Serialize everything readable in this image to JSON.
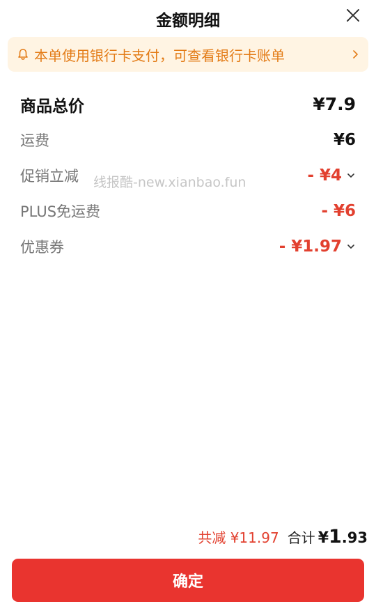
{
  "header": {
    "title": "金额明细"
  },
  "notice": {
    "text": "本单使用银行卡支付，可查看银行卡账单"
  },
  "rows": [
    {
      "label": "商品总价",
      "value": "¥7.9"
    },
    {
      "label": "运费",
      "value": "¥6"
    },
    {
      "label": "促销立减",
      "value": "- ¥4"
    },
    {
      "label": "PLUS免运费",
      "value": "- ¥6"
    },
    {
      "label": "优惠券",
      "value": "- ¥1.97"
    }
  ],
  "watermark": "线报酷-new.xianbao.fun",
  "summary": {
    "saved": "共减 ¥11.97",
    "total_label": "合计",
    "total_symbol": "¥",
    "total_integer": "1",
    "total_decimal": ".93"
  },
  "confirm_label": "确定",
  "colors": {
    "accent_red": "#e2402f",
    "button_red": "#e9342f",
    "notice_bg": "#fff4e3",
    "notice_text": "#e37b16"
  }
}
